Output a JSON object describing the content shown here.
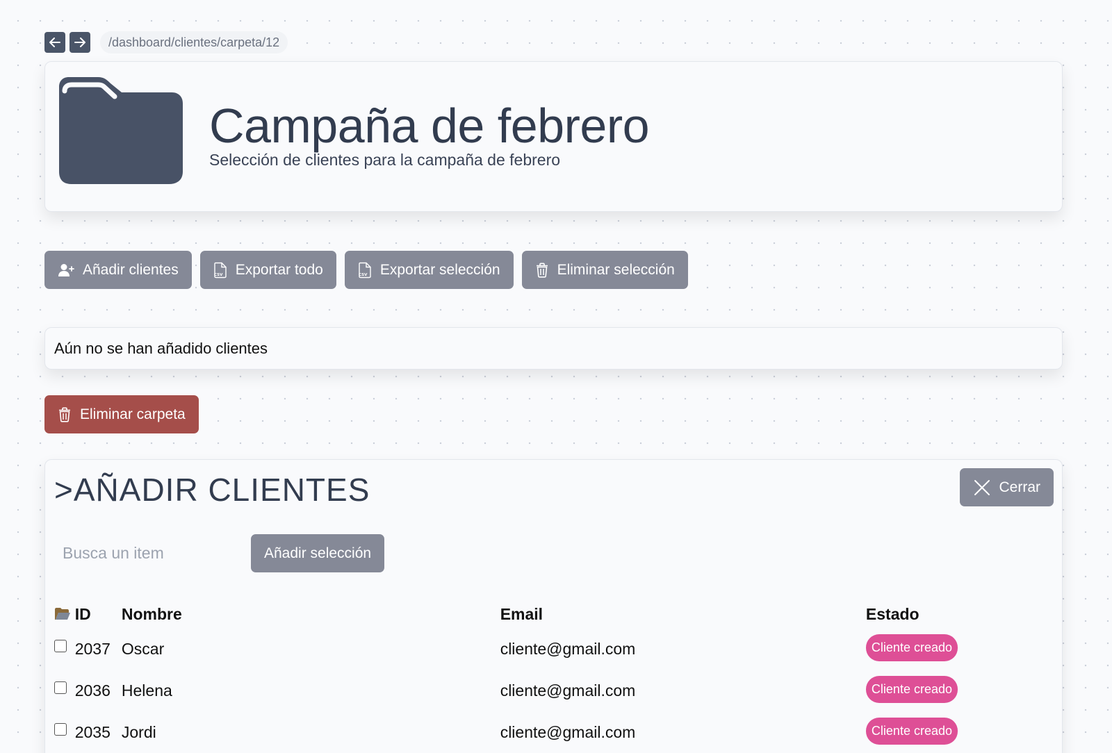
{
  "nav": {
    "back_label": "Atrás",
    "forward_label": "Adelante",
    "breadcrumb": "/dashboard/clientes/carpeta/12"
  },
  "folder": {
    "title": "Campaña de febrero",
    "subtitle": "Selección de clientes para la campaña de febrero"
  },
  "actions": {
    "add_clients": "Añadir clientes",
    "export_all": "Exportar todo",
    "export_selection": "Exportar selección",
    "delete_selection": "Eliminar selección"
  },
  "empty_message": "Aún no se han añadido clientes",
  "delete_folder": "Eliminar carpeta",
  "add_panel": {
    "title": ">AÑADIR CLIENTES",
    "close_label": "Cerrar",
    "search_placeholder": "Busca un item",
    "search_value": "",
    "add_selection": "Añadir selección",
    "columns": {
      "id": "ID",
      "name": "Nombre",
      "email": "Email",
      "status": "Estado"
    },
    "rows": [
      {
        "id": "2037",
        "name": "Oscar",
        "email": "cliente@gmail.com",
        "status": "Cliente creado"
      },
      {
        "id": "2036",
        "name": "Helena",
        "email": "cliente@gmail.com",
        "status": "Cliente creado"
      },
      {
        "id": "2035",
        "name": "Jordi",
        "email": "cliente@gmail.com",
        "status": "Cliente creado"
      }
    ]
  },
  "colors": {
    "button_gray": "#858997",
    "danger": "#a54e4a",
    "badge_pink": "#de4f96",
    "folder_icon": "#485266",
    "title_text": "#323c4f"
  },
  "icons": {
    "back": "arrow-left-icon",
    "forward": "arrow-right-icon",
    "folder": "folder-icon",
    "add_user": "user-plus-icon",
    "csv": "csv-file-icon",
    "trash": "trash-icon",
    "close": "close-icon",
    "header_folder": "open-folder-icon"
  }
}
